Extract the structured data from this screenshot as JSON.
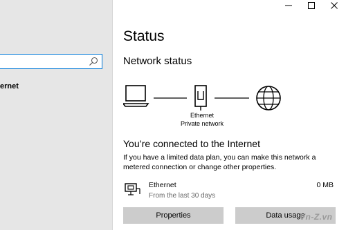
{
  "window": {
    "minimize_icon": "minimize-icon",
    "maximize_icon": "maximize-icon",
    "close_icon": "close-icon"
  },
  "sidebar": {
    "search": {
      "value": "",
      "placeholder": "",
      "icon": "search-icon"
    },
    "nav_item_partial": "ernet"
  },
  "main": {
    "title": "Status",
    "section_title": "Network status",
    "diagram": {
      "device_icon": "laptop-icon",
      "adapter_icon": "ethernet-port-icon",
      "internet_icon": "globe-icon",
      "adapter_name": "Ethernet",
      "network_name": "Private network"
    },
    "connection": {
      "title": "You’re connected to the Internet",
      "description": "If you have a limited data plan, you can make this network a metered connection or change other properties."
    },
    "usage": {
      "icon": "ethernet-adapter-icon",
      "name": "Ethernet",
      "period": "From the last 30 days",
      "amount": "0 MB"
    },
    "buttons": {
      "properties": "Properties",
      "data_usage": "Data usage"
    }
  },
  "watermark": "Vn-Z.vn",
  "colors": {
    "accent": "#0078d7",
    "sidebar_bg": "#e6e6e6",
    "button_bg": "#cccccc"
  }
}
